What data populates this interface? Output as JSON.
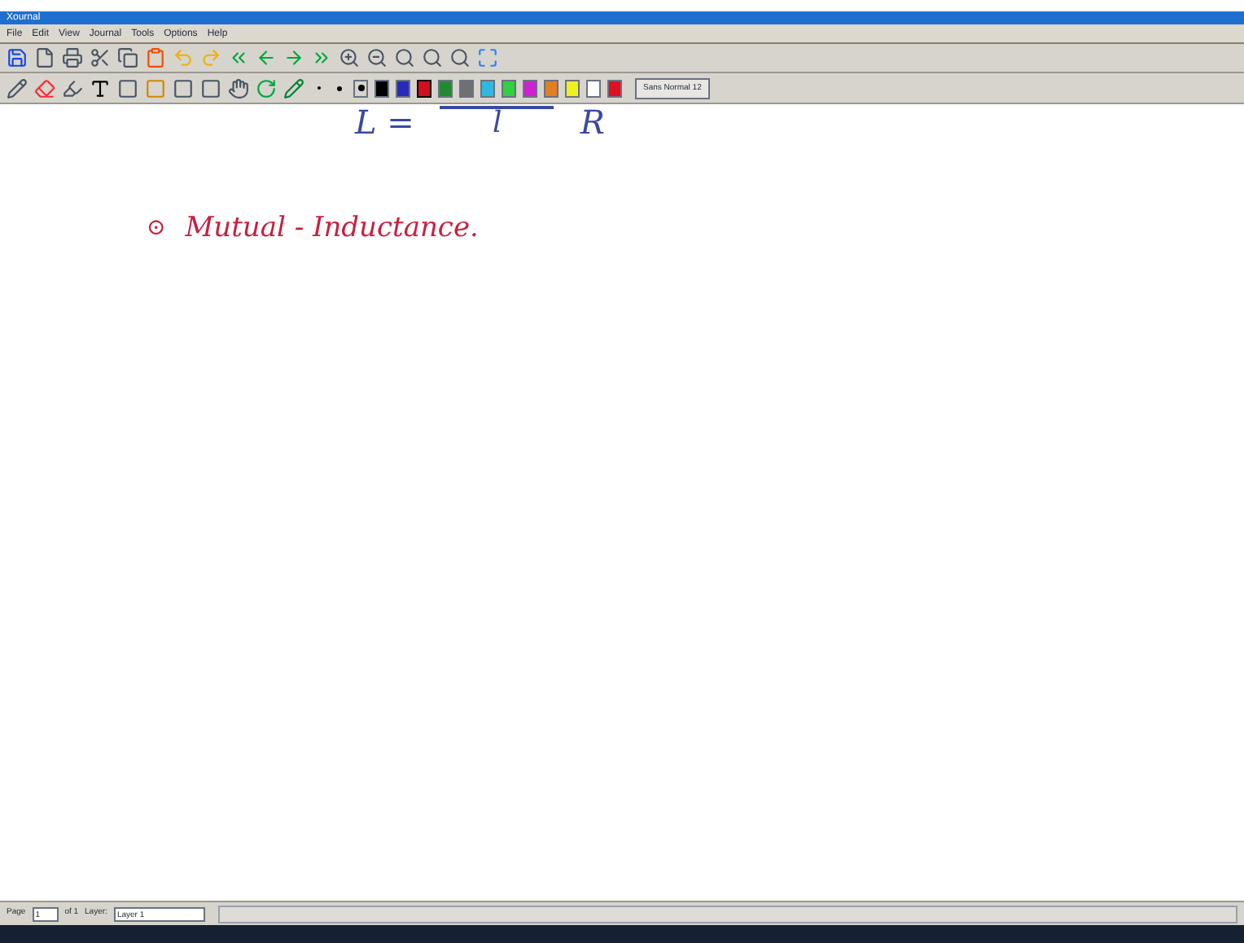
{
  "window": {
    "title": "Xournal"
  },
  "menu": [
    "File",
    "Edit",
    "View",
    "Journal",
    "Tools",
    "Options",
    "Help"
  ],
  "font": {
    "label": "Sans Normal 12"
  },
  "pen_sizes": [
    {
      "selected": false
    },
    {
      "selected": false
    },
    {
      "selected": true
    }
  ],
  "colors": [
    {
      "color": "#000000",
      "selected": false
    },
    {
      "color": "#2a2ab8",
      "selected": false
    },
    {
      "color": "#d01020",
      "selected": true
    },
    {
      "color": "#208a30",
      "selected": false
    },
    {
      "color": "#707070",
      "selected": false
    },
    {
      "color": "#30b8e0",
      "selected": false
    },
    {
      "color": "#30d040",
      "selected": false
    },
    {
      "color": "#d020d0",
      "selected": false
    },
    {
      "color": "#e08020",
      "selected": false
    },
    {
      "color": "#f0f020",
      "selected": false
    },
    {
      "color": "#ffffff",
      "selected": false
    },
    {
      "color": "#e01020",
      "selected": false
    }
  ],
  "ink": [
    {
      "kind": "formula",
      "lhs": "L =",
      "denominator": "l",
      "rhs": "R",
      "color": "#3a4aa0"
    },
    {
      "kind": "line",
      "bullet": "⊙",
      "text": "Mutual - Inductance.",
      "color": "#c82040"
    }
  ],
  "status": {
    "page_label": "Page",
    "page": "1",
    "of": "of 1",
    "layer_label": "Layer:",
    "layer": "Layer 1"
  }
}
